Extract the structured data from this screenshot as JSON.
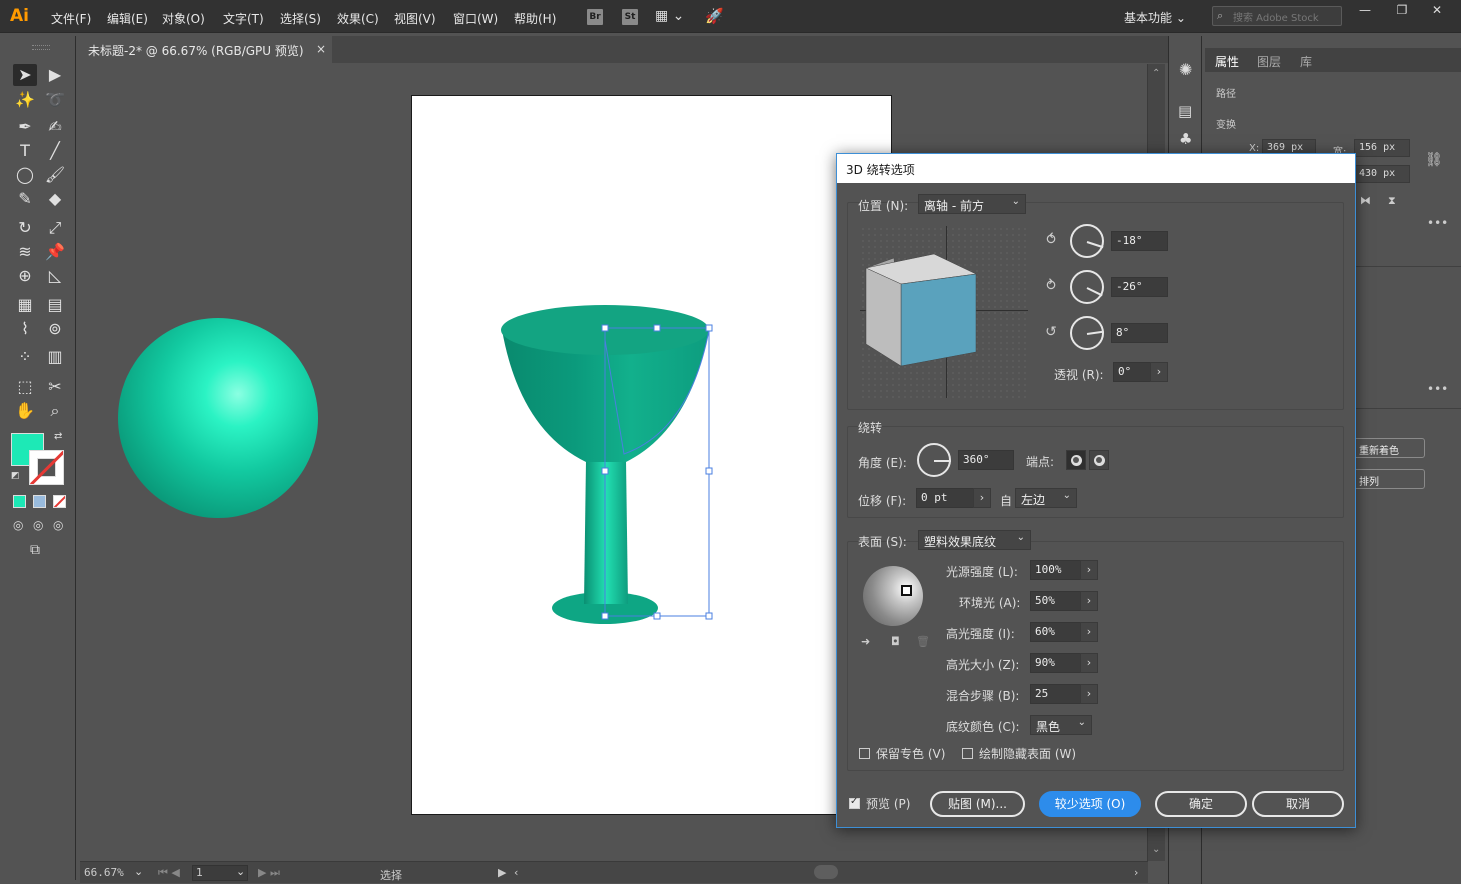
{
  "app": {
    "logo": "Ai",
    "menus": [
      "文件(F)",
      "编辑(E)",
      "对象(O)",
      "文字(T)",
      "选择(S)",
      "效果(C)",
      "视图(V)",
      "窗口(W)",
      "帮助(H)"
    ],
    "bridge_label": "Br",
    "stock_label": "St",
    "workspace": "基本功能",
    "search_placeholder": "搜索 Adobe Stock"
  },
  "document": {
    "tab_title": "未标题-2* @ 66.67% (RGB/GPU 预览)",
    "zoom": "66.67%",
    "page": "1",
    "status_tool": "选择"
  },
  "colors": {
    "fill": "#1de9b6",
    "teal_dark": "#009477",
    "teal_light": "#6ff7d4",
    "accent": "#2d8ceb",
    "panel": "#535353"
  },
  "right_panel": {
    "tabs": [
      "属性",
      "图层",
      "库"
    ],
    "section_path": "路径",
    "section_transform": "变换",
    "x_label": "X:",
    "x_value": "369 px",
    "w_label": "宽:",
    "w_value": "156 px",
    "h_value": "430 px",
    "recolor_button": "重新着色",
    "arrange_button": "排列"
  },
  "dialog": {
    "title": "3D 绕转选项",
    "position_label": "位置 (N):",
    "position_value": "离轴 - 前方",
    "rot_x": "-18°",
    "rot_y": "-26°",
    "rot_z": "8°",
    "perspective_label": "透视 (R):",
    "perspective_value": "0°",
    "revolve_section": "绕转",
    "angle_label": "角度 (E):",
    "angle_value": "360°",
    "cap_label": "端点:",
    "offset_label": "位移 (F):",
    "offset_value": "0 pt",
    "from_label": "自",
    "from_value": "左边",
    "surface_label": "表面 (S):",
    "surface_value": "塑料效果底纹",
    "light_intensity_label": "光源强度 (L):",
    "light_intensity": "100%",
    "ambient_label": "环境光 (A):",
    "ambient": "50%",
    "highlight_intensity_label": "高光强度 (I):",
    "highlight_intensity": "60%",
    "highlight_size_label": "高光大小 (Z):",
    "highlight_size": "90%",
    "blend_steps_label": "混合步骤 (B):",
    "blend_steps": "25",
    "shading_color_label": "底纹颜色 (C):",
    "shading_color": "黑色",
    "preserve_spot_label": "保留专色 (V)",
    "draw_hidden_label": "绘制隐藏表面 (W)",
    "preview_label": "预览 (P)",
    "map_art_button": "贴图 (M)...",
    "fewer_options_button": "较少选项 (O)",
    "ok_button": "确定",
    "cancel_button": "取消"
  }
}
